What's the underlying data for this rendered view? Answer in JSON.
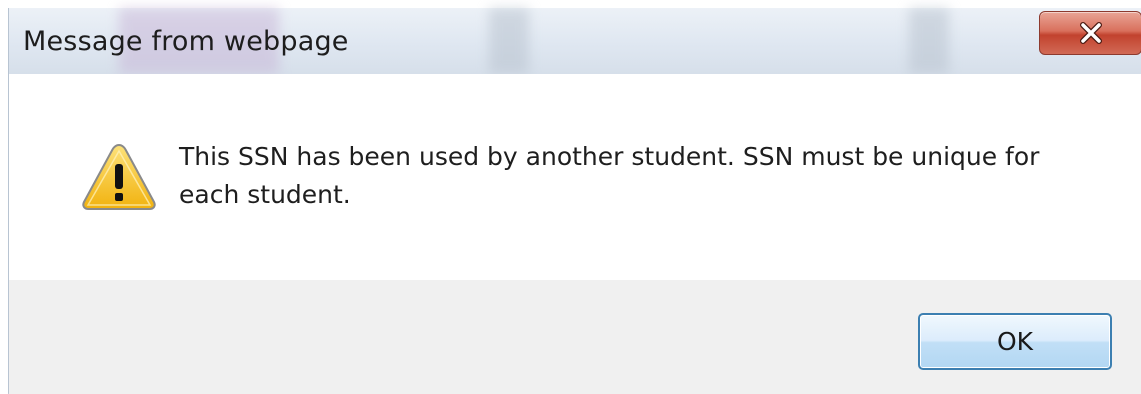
{
  "dialog": {
    "title": "Message from webpage",
    "message": "This SSN has been used by another student. SSN must be unique for each student.",
    "ok_label": "OK",
    "close_icon": "close-icon",
    "status_icon": "warning-icon"
  },
  "colors": {
    "title_bar": "#dfe7f1",
    "content_bg": "#ffffff",
    "footer_bg": "#f0f0f0",
    "close_button": "#c7503d",
    "ok_border": "#3c7fb1",
    "warning_fill": "#f6c324"
  }
}
